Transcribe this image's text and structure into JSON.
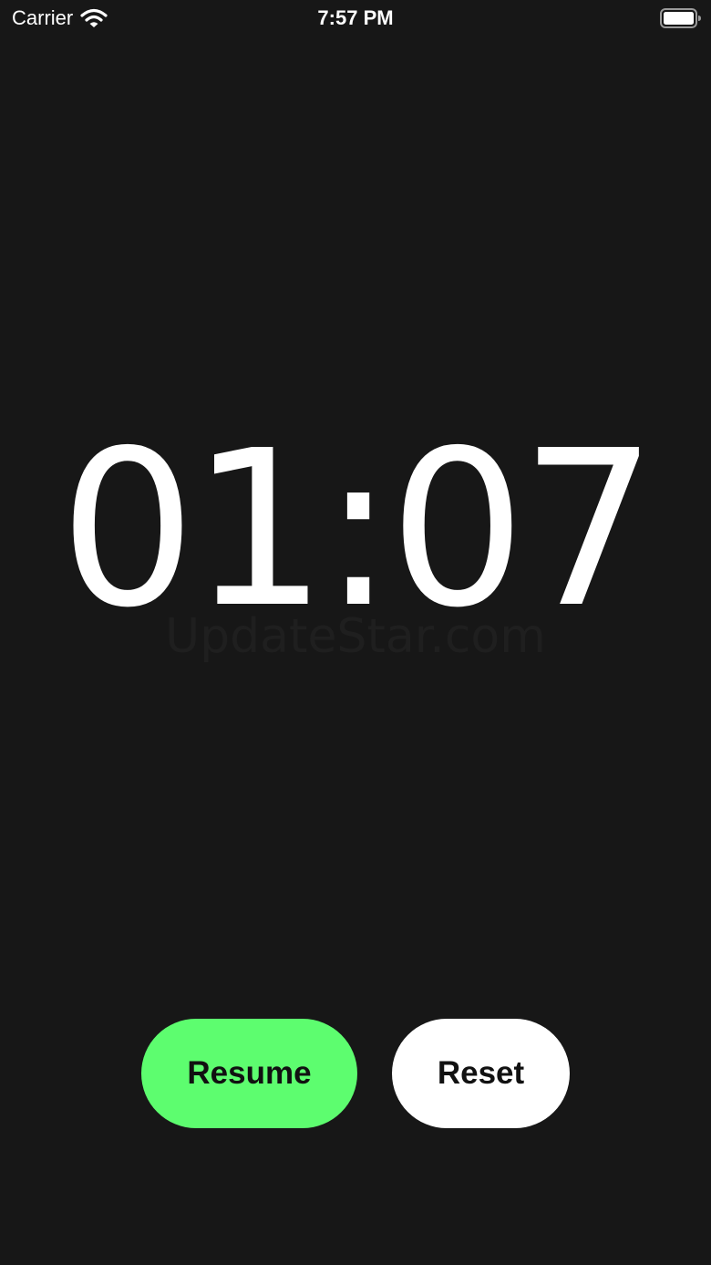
{
  "status_bar": {
    "carrier": "Carrier",
    "time": "7:57 PM",
    "wifi_icon": "wifi-icon",
    "battery_icon": "battery-icon"
  },
  "timer": {
    "display": "01:07"
  },
  "watermark": {
    "text": "UpdateStar.com"
  },
  "controls": {
    "resume_label": "Resume",
    "reset_label": "Reset"
  },
  "colors": {
    "background": "#171717",
    "resume_button": "#5dfd6f",
    "reset_button": "#ffffff",
    "button_text": "#111111",
    "timer_text": "#ffffff"
  }
}
